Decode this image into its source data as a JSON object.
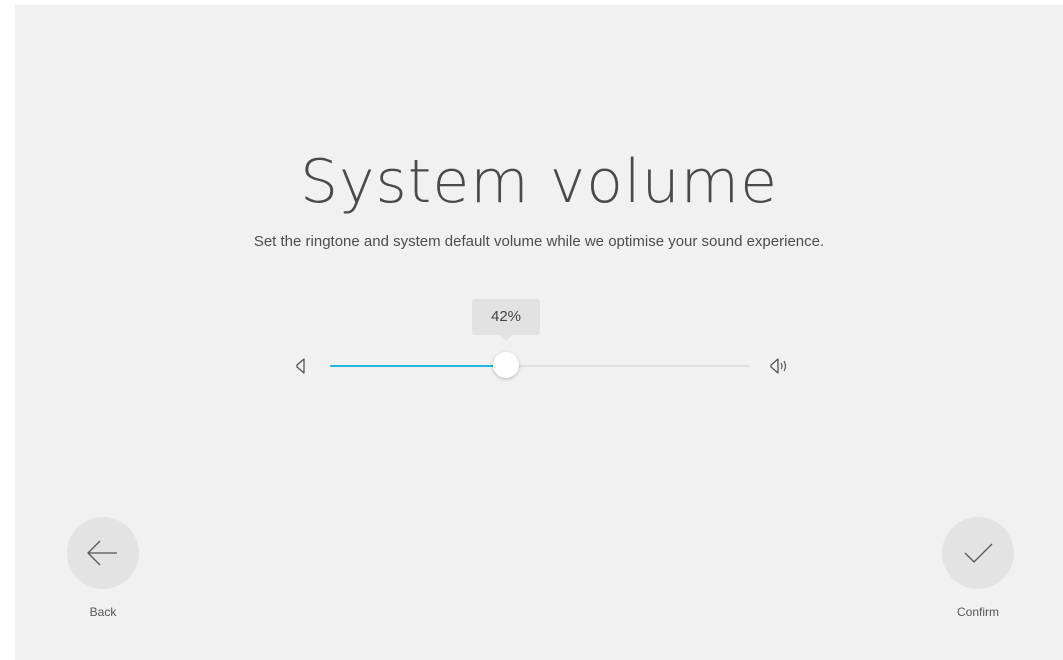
{
  "page": {
    "title": "System volume",
    "subtitle": "Set the ringtone and system default volume while we optimise your sound experience."
  },
  "volume": {
    "value": 0.42,
    "label": "42%",
    "low_icon": "volume-low-icon",
    "high_icon": "volume-high-icon",
    "fill_color": "#1fb6df"
  },
  "navigation": {
    "back_label": "Back",
    "back_icon": "arrow-left-icon",
    "confirm_label": "Confirm",
    "confirm_icon": "checkmark-icon"
  }
}
